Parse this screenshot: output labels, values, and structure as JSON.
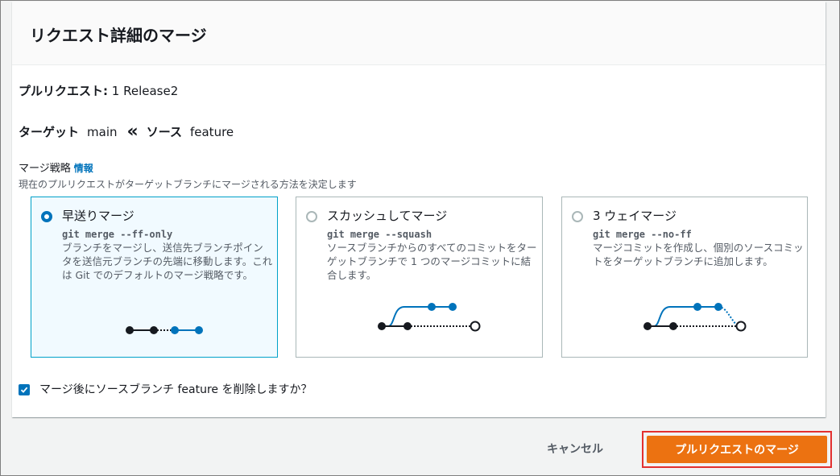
{
  "dialog": {
    "title": "リクエスト詳細のマージ",
    "pull_request": {
      "label": "プルリクエスト:",
      "value": "1 Release2"
    },
    "target": {
      "label": "ターゲット",
      "value": "main"
    },
    "source": {
      "label": "ソース",
      "value": "feature"
    },
    "strategy": {
      "label": "マージ戦略",
      "info_link": "情報",
      "description": "現在のプルリクエストがターゲットブランチにマージされる方法を決定します",
      "selected": "fast-forward",
      "options": [
        {
          "title": "早送りマージ",
          "command": "git merge --ff-only",
          "description": "ブランチをマージし、送信先ブランチポインタを送信元ブランチの先端に移動します。これは Git でのデフォルトのマージ戦略です。"
        },
        {
          "title": "スカッシュしてマージ",
          "command": "git merge --squash",
          "description": "ソースブランチからのすべてのコミットをターゲットブランチで 1 つのマージコミットに結合します。"
        },
        {
          "title": "3 ウェイマージ",
          "command": "git merge --no-ff",
          "description": "マージコミットを作成し、個別のソースコミットをターゲットブランチに追加します。"
        }
      ]
    },
    "delete_branch": {
      "label": "マージ後にソースブランチ feature を削除しますか？",
      "checked": true
    }
  },
  "footer": {
    "cancel_label": "キャンセル",
    "merge_label": "プルリクエストのマージ"
  },
  "colors": {
    "accent": "#0073bb",
    "primary_button": "#ec7211",
    "highlight_border": "#e3302f",
    "selected_card_border": "#00a1c9",
    "diagram_node": "#16191f"
  }
}
